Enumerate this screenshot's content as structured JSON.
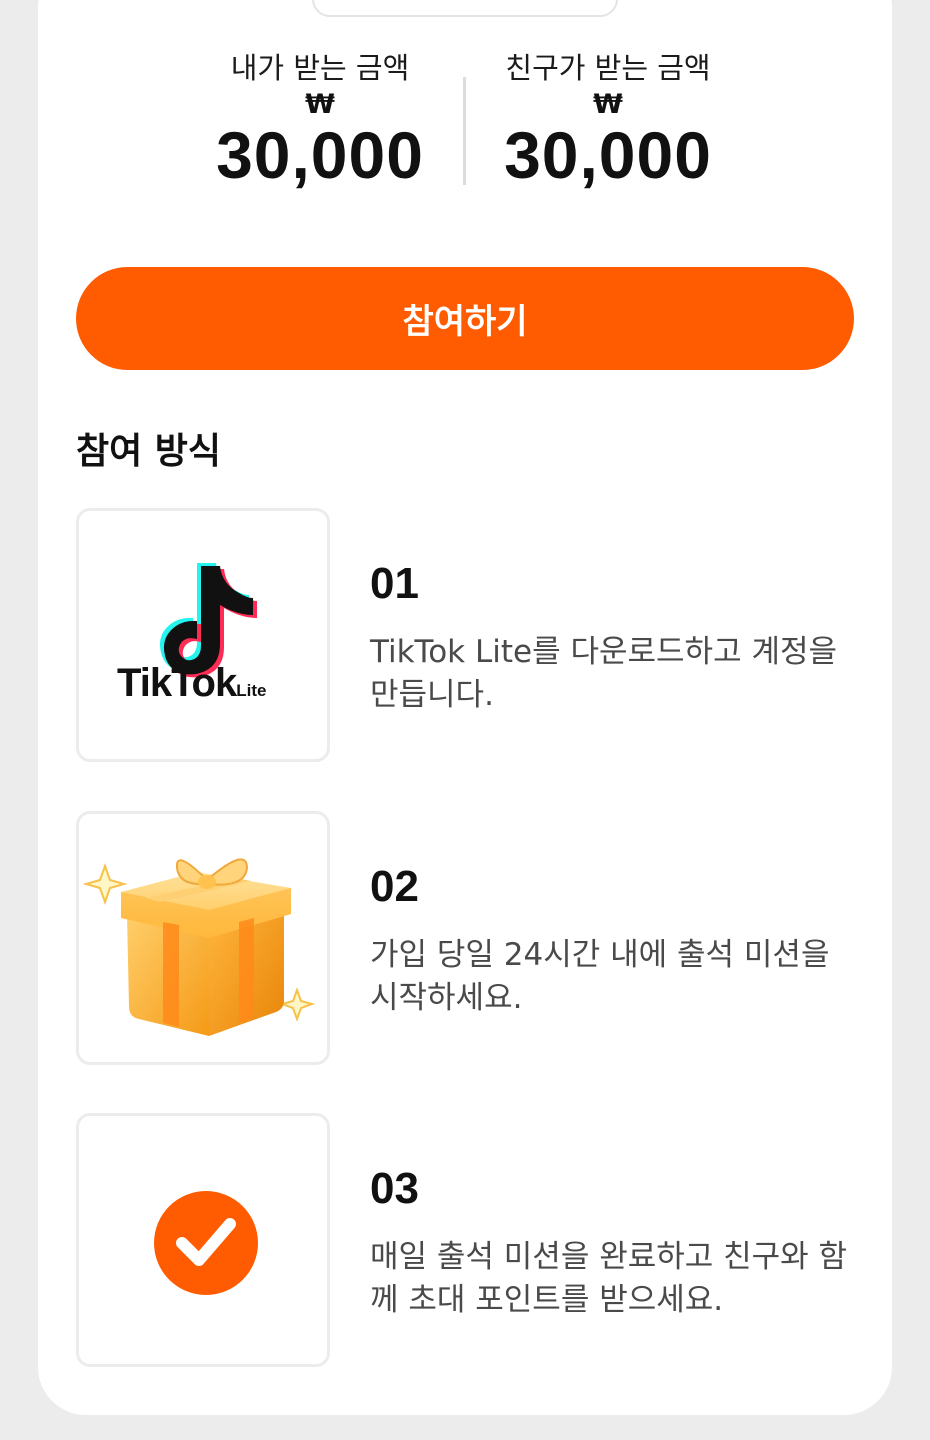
{
  "rewards": {
    "mine": {
      "label": "내가 받는 금액",
      "currency": "₩",
      "amount": "30,000"
    },
    "friend": {
      "label": "친구가 받는 금액",
      "currency": "₩",
      "amount": "30,000"
    }
  },
  "cta": {
    "label": "참여하기"
  },
  "section": {
    "title": "참여 방식"
  },
  "steps": [
    {
      "number": "01",
      "description": "TikTok Lite를 다운로드하고 계정을 만듭니다.",
      "icon": "tiktok-lite-logo",
      "logo_text": "TikTok",
      "logo_sub": "Lite"
    },
    {
      "number": "02",
      "description": "가입 당일 24시간 내에 출석 미션을 시작하세요.",
      "icon": "gift-box-icon"
    },
    {
      "number": "03",
      "description": "매일 출석 미션을 완료하고 친구와 함께 초대 포인트를 받으세요.",
      "icon": "checkmark-circle-icon"
    }
  ],
  "colors": {
    "accent": "#ff5b00",
    "text": "#111111",
    "muted": "#4a4a4a",
    "background": "#ececec"
  }
}
